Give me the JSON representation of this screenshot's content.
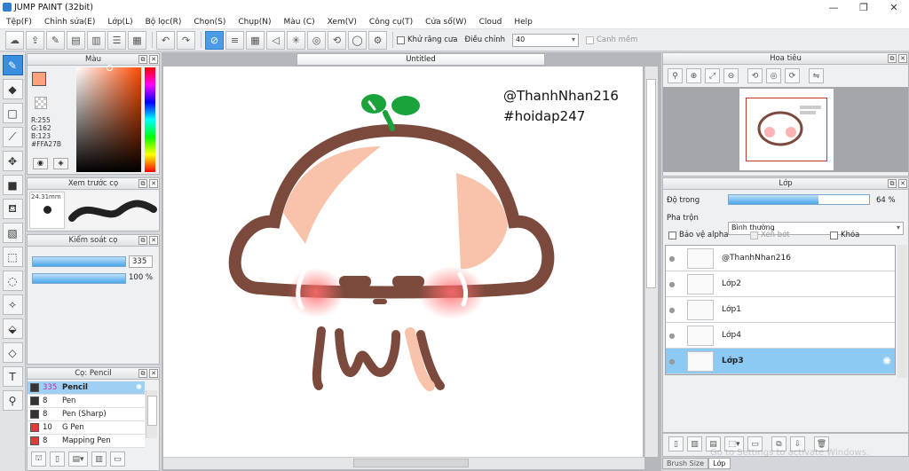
{
  "window": {
    "title": "JUMP PAINT (32bit)",
    "buttons": [
      "—",
      "❐",
      "✕"
    ]
  },
  "menu": [
    "Tệp(F)",
    "Chỉnh sửa(E)",
    "Lớp(L)",
    "Bộ lọc(R)",
    "Chọn(S)",
    "Chụp(N)",
    "Màu (C)",
    "Xem(V)",
    "Công cụ(T)",
    "Cửa sổ(W)",
    "Cloud",
    "Help"
  ],
  "toolbar": {
    "antialias_label": "Khử răng cưa",
    "adjust_label": "Điều chỉnh",
    "adjust_value": "40",
    "snap_label": "Canh mềm"
  },
  "color_panel": {
    "title": "Màu",
    "r": "R:255",
    "g": "G:162",
    "b": "B:123",
    "hex": "#FFA27B",
    "main_color": "#FFA27B"
  },
  "brush_preview": {
    "title": "Xem trước cọ",
    "size": "24.31mm"
  },
  "brush_control": {
    "title": "Kiểm soát cọ",
    "size_value": "335",
    "opacity_value": "100 %",
    "size_frac": 1.0,
    "opacity_frac": 1.0
  },
  "brush_list": {
    "title": "Cọ: Pencil",
    "items": [
      {
        "size": "335",
        "name": "Pencil",
        "color": "#333333"
      },
      {
        "size": "8",
        "name": "Pen",
        "color": "#333333"
      },
      {
        "size": "8",
        "name": "Pen (Sharp)",
        "color": "#333333"
      },
      {
        "size": "10",
        "name": "G Pen",
        "color": "#e03b3b"
      },
      {
        "size": "8",
        "name": "Mapping Pen",
        "color": "#e03b3b"
      }
    ]
  },
  "canvas": {
    "tab": "Untitled",
    "text1": "@ThanhNhan216",
    "text2": "#hoidap247"
  },
  "navigator": {
    "title": "Hoa tiêu"
  },
  "layers": {
    "title": "Lớp",
    "opacity_label": "Độ trong",
    "opacity_value": "64 %",
    "opacity_frac": 0.64,
    "blend_label": "Pha trộn",
    "blend_value": "Bình thường",
    "protect_alpha": "Bảo vệ alpha",
    "clipping": "Xén bớt",
    "lock": "Khóa",
    "items": [
      {
        "name": "@ThanhNhan216"
      },
      {
        "name": "Lớp2"
      },
      {
        "name": "Lớp1"
      },
      {
        "name": "Lớp4"
      },
      {
        "name": "Lớp3"
      }
    ]
  },
  "bottom_tabs": [
    "Brush Size",
    "Lớp"
  ],
  "watermark": "Go to Settings to activate Windows."
}
